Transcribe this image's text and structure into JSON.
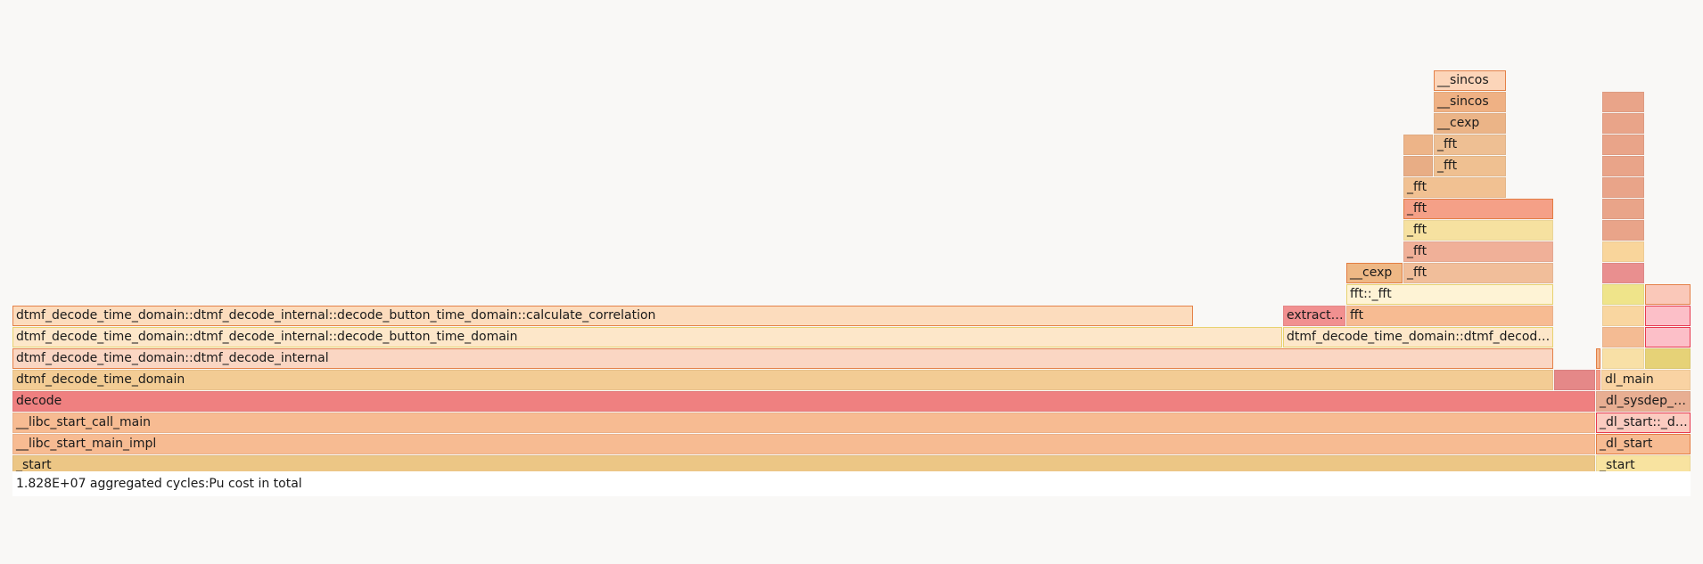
{
  "total_label": "1.828E+07 aggregated cycles:Pu cost in total",
  "frames": [
    {
      "label": "_start",
      "color": "#ecc685"
    },
    {
      "label": "__libc_start_main_impl",
      "color": "#f7bb92"
    },
    {
      "label": "__libc_start_call_main",
      "color": "#f7bb92"
    },
    {
      "label": "decode",
      "color": "#ef8080"
    },
    {
      "label": "dtmf_decode_time_domain",
      "color": "#f3cc94"
    },
    {
      "label": "",
      "color": "#e58888"
    },
    {
      "label": "dtmf_decode_time_domain::dtmf_decode_internal",
      "color": "#fad6c3"
    },
    {
      "label": "dtmf_decode_time_domain::dtmf_decode_internal::decode_button_time_domain",
      "color": "#fde7c9"
    },
    {
      "label": "dtmf_decode_time_domain::dtmf_decode_internal::decode_button_time_domain::calculate_correlation",
      "color": "#fcdcbd"
    },
    {
      "label": "dtmf_decode_time_domain::dtmf_decode_internal::decode_frame",
      "color": "#fde7c9"
    },
    {
      "label": "extract_frequency",
      "color": "#f19090"
    },
    {
      "label": "fft",
      "color": "#f7bb92"
    },
    {
      "label": "fft::_fft",
      "color": "#fef3d5"
    },
    {
      "label": "__cexp",
      "color": "#eeb885"
    },
    {
      "label": "_fft",
      "color": "#f1be9a"
    },
    {
      "label": "_fft",
      "color": "#f0b098"
    },
    {
      "label": "_fft",
      "color": "#f6e1a0"
    },
    {
      "label": "_fft",
      "color": "#f5a087"
    },
    {
      "label": "_fft",
      "color": "#f1c192"
    },
    {
      "label": "",
      "color": "#e8ad85"
    },
    {
      "label": "_fft",
      "color": "#efc091"
    },
    {
      "label": "",
      "color": "#edb488"
    },
    {
      "label": "_fft",
      "color": "#eebf93"
    },
    {
      "label": "__cexp",
      "color": "#ebb487"
    },
    {
      "label": "__sincos",
      "color": "#efb184"
    },
    {
      "label": "__sincos",
      "color": "#fcd5b9"
    },
    {
      "label": "_start",
      "color": "#f8e3a0"
    },
    {
      "label": "_dl_start",
      "color": "#f7bb92"
    },
    {
      "label": "_dl_start::_dl_start_final",
      "color": "#fbcbc0"
    },
    {
      "label": "_dl_sysdep_start",
      "color": "#e8ae92"
    },
    {
      "label": "dl_main",
      "color": "#f9d3a3"
    },
    {
      "label": "",
      "color": "#f59b88"
    },
    {
      "label": "",
      "color": "#f7d9a0"
    },
    {
      "label": "",
      "color": "#f8e0a6"
    },
    {
      "label": "",
      "color": "#e6d277"
    },
    {
      "label": "",
      "color": "#f4bb93"
    },
    {
      "label": "",
      "color": "#fcbfc8"
    },
    {
      "label": "",
      "color": "#f9d6a0"
    },
    {
      "label": "",
      "color": "#fcbfc8"
    },
    {
      "label": "",
      "color": "#efe48a"
    },
    {
      "label": "",
      "color": "#fac8b9"
    },
    {
      "label": "",
      "color": "#e98f8f"
    },
    {
      "label": "",
      "color": "#f9d59b"
    },
    {
      "label": "",
      "color": "#e9a489"
    },
    {
      "label": "",
      "color": "#e9a489"
    },
    {
      "label": "",
      "color": "#e9a489"
    },
    {
      "label": "",
      "color": "#e9a489"
    },
    {
      "label": "",
      "color": "#e9a489"
    },
    {
      "label": "",
      "color": "#e9a489"
    },
    {
      "label": "",
      "color": "#e9a489"
    }
  ]
}
